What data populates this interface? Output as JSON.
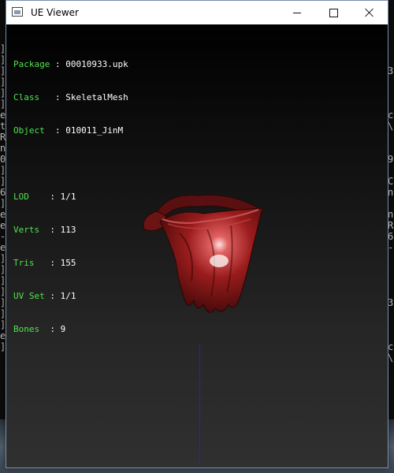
{
  "window": {
    "title": "UE Viewer"
  },
  "info_panel": {
    "rows": [
      {
        "key": "Package",
        "sep": ":",
        "value": "00010933.upk"
      },
      {
        "key": "Class",
        "sep": ":",
        "value": "SkeletalMesh"
      },
      {
        "key": "Object",
        "sep": ":",
        "value": "010011_JinM"
      }
    ],
    "stats": [
      {
        "key": "LOD",
        "sep": ":",
        "value": "1/1"
      },
      {
        "key": "Verts",
        "sep": ":",
        "value": "113"
      },
      {
        "key": "Tris",
        "sep": ":",
        "value": "155"
      },
      {
        "key": "UV Set",
        "sep": ":",
        "value": "1/1"
      },
      {
        "key": "Bones",
        "sep": ":",
        "value": "9"
      }
    ],
    "key_color": "#4fe34f",
    "value_color": "#ffffff"
  },
  "background_console": {
    "left_chars": [
      "]",
      "]",
      "]",
      "]",
      "]",
      "]",
      "e",
      "t",
      "R",
      "n",
      "0",
      "]",
      "]",
      "6",
      "]",
      "e",
      "e",
      "-",
      "e",
      "]",
      "]",
      "]",
      "]",
      "]",
      "]",
      "]",
      "e",
      "]"
    ],
    "right_chars": [
      "",
      "",
      "3",
      "",
      "",
      "",
      "c",
      "\\",
      "",
      "",
      "9",
      "",
      "C",
      "n",
      "",
      "n",
      "R",
      "6",
      "-",
      "",
      "",
      "",
      "",
      "3",
      "",
      "",
      "",
      "c",
      "\\"
    ]
  },
  "colors": {
    "mesh_primary": "#8b1a1a",
    "axis_line": "#1f2aa8"
  }
}
